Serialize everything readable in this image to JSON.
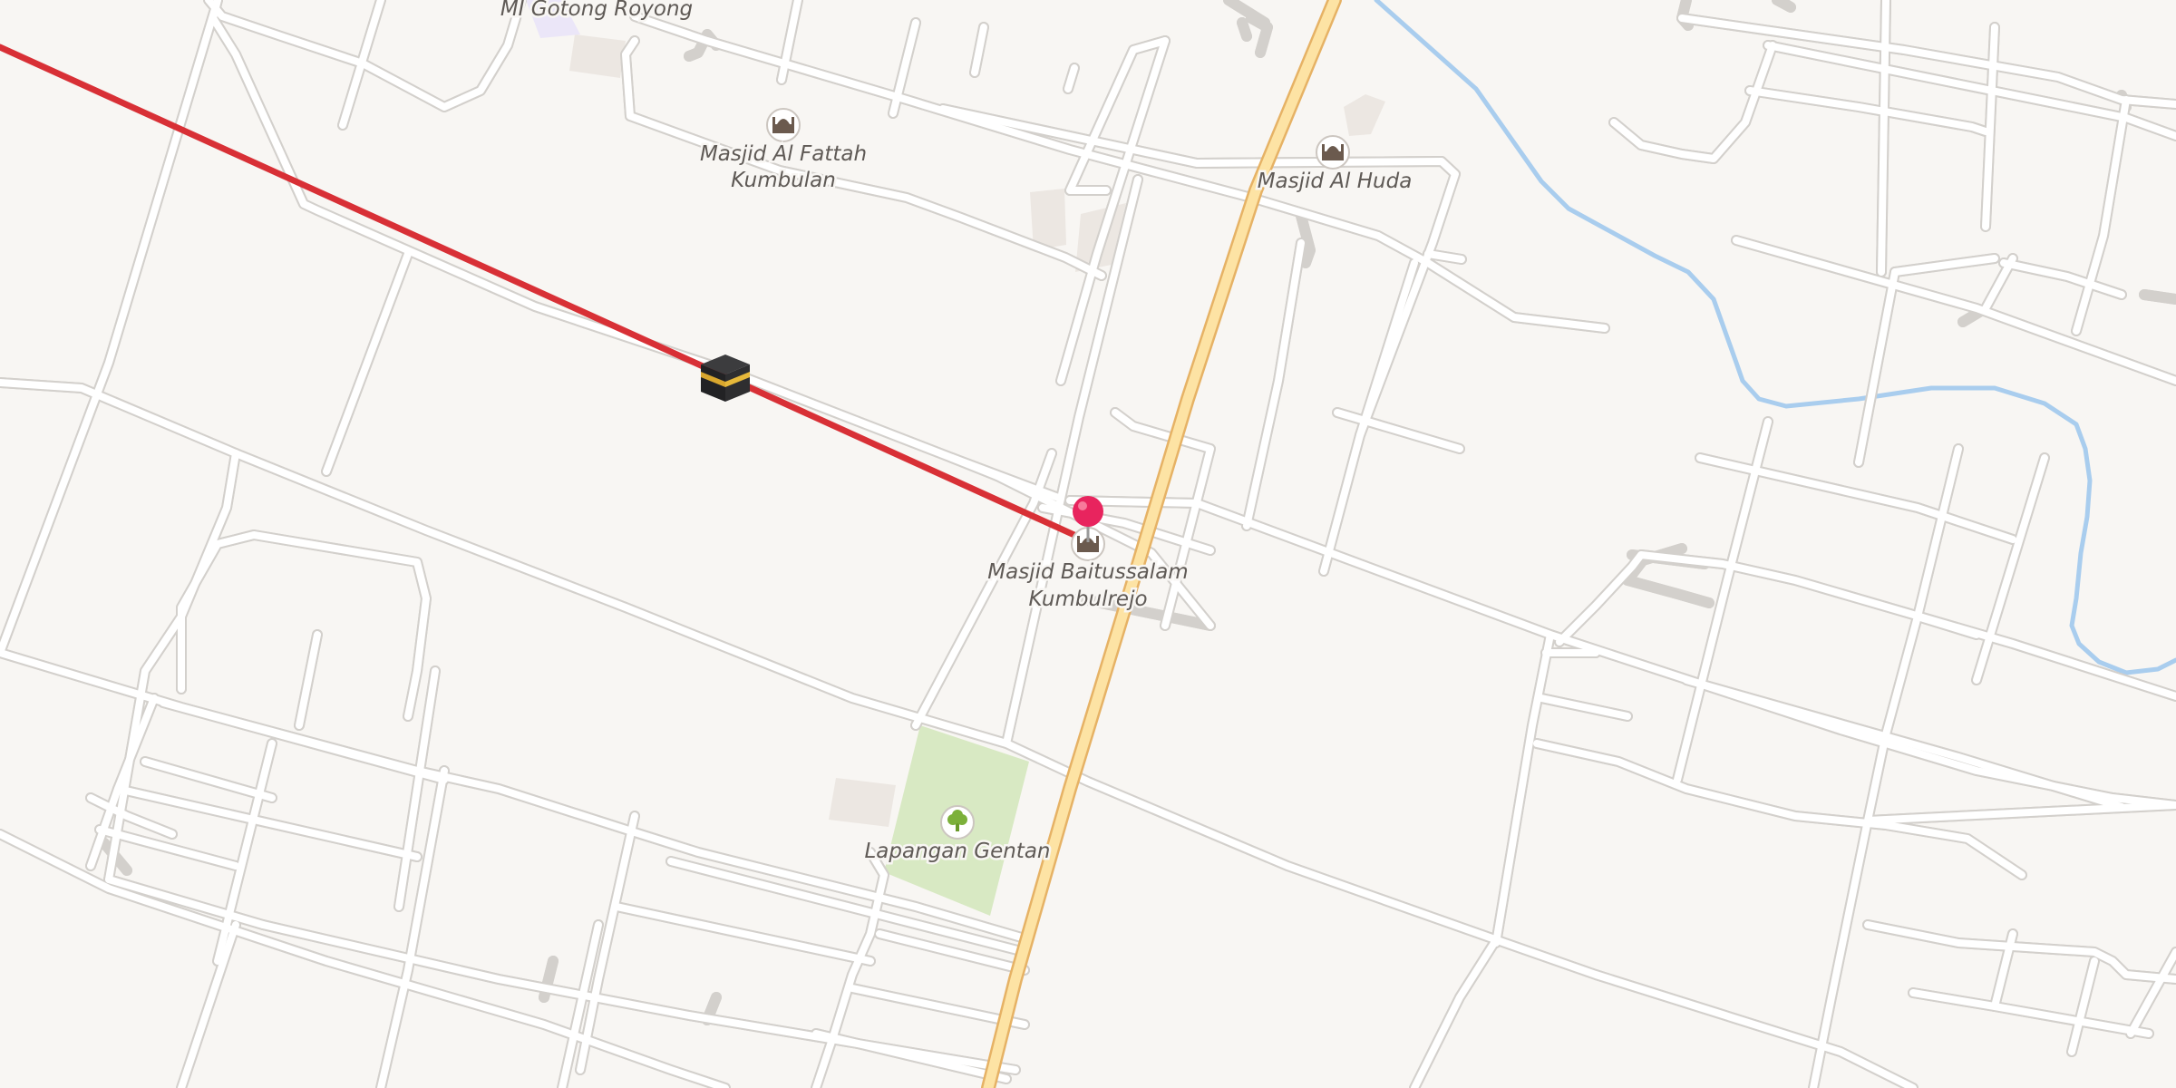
{
  "map": {
    "labels": {
      "school": "MI Gotong Royong",
      "mosque_fattah_1": "Masjid Al Fattah",
      "mosque_fattah_2": "Kumbulan",
      "mosque_huda": "Masjid Al Huda",
      "mosque_baitussalam_1": "Masjid Baitussalam",
      "mosque_baitussalam_2": "Kumbulrejo",
      "park": "Lapangan Gentan"
    },
    "icons": {
      "mosque": "mosque-icon",
      "park": "tree-icon",
      "kaaba": "kaaba-icon",
      "location_pin": "location-pin-icon"
    },
    "colors": {
      "background": "#f8f6f3",
      "road": "#ffffff",
      "road_casing": "#d3d0cc",
      "main_road": "#fde3a4",
      "main_road_casing": "#e6b265",
      "river": "#a9cdee",
      "park": "#d8e9c3",
      "qibla_line": "#d83036",
      "pin": "#e8245e",
      "poi_icon": "#6b5a4e",
      "label": "#5f5a56"
    }
  }
}
